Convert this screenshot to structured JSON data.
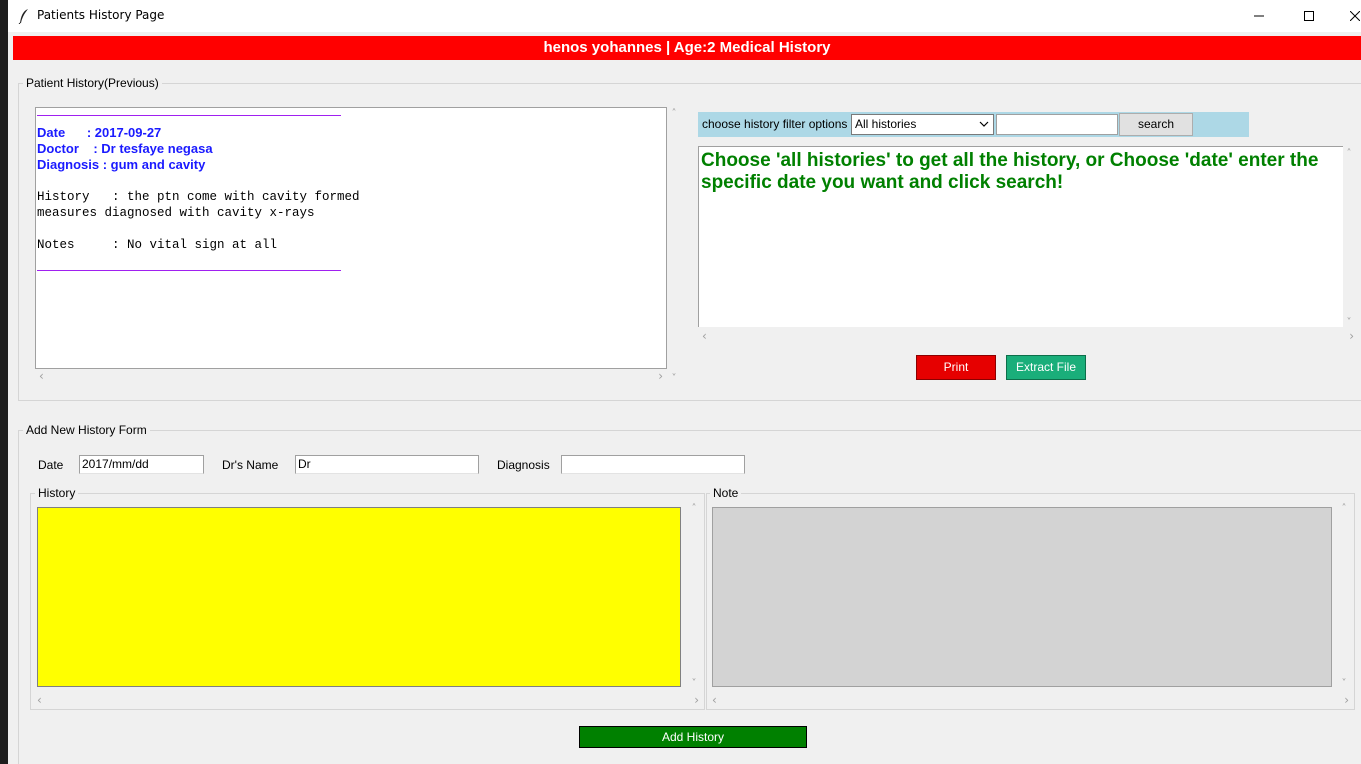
{
  "window": {
    "title": "Patients History Page"
  },
  "banner": {
    "text": "henos yohannes | Age:2  Medical History",
    "color": "#ff0000"
  },
  "previous_section": {
    "label": "Patient History(Previous)",
    "record": {
      "date_line": "Date      : 2017-09-27",
      "doctor_line": "Doctor    : Dr tesfaye negasa",
      "diagnosis_line": "Diagnosis : gum and cavity",
      "history_line1": "History   : the ptn come with cavity formed",
      "history_line2": "measures diagnosed with cavity x-rays",
      "notes_line": "Notes     : No vital sign at all"
    }
  },
  "filter": {
    "label": "choose history filter options",
    "selected_option": "All histories",
    "search_value": "",
    "search_button": "search"
  },
  "result": {
    "message": "Choose 'all histories' to get all the history, or Choose 'date' enter the specific date you want and click search!"
  },
  "actions": {
    "print_label": "Print",
    "extract_label": "Extract File"
  },
  "add_form": {
    "label": "Add New History Form",
    "date_label": "Date",
    "date_value": "2017/mm/dd",
    "doctor_label": "Dr's Name",
    "doctor_value": "Dr",
    "diagnosis_label": "Diagnosis",
    "diagnosis_value": "",
    "history_label": "History",
    "note_label": "Note",
    "add_button": "Add History"
  },
  "colors": {
    "history_bg": "#ffff00",
    "note_bg": "#d3d3d3",
    "print_btn": "#e60000",
    "extract_btn": "#1aae7a",
    "add_btn": "#008000",
    "result_text": "#008000",
    "record_header_text": "#1a1aff",
    "filter_bar": "#add8e6"
  }
}
